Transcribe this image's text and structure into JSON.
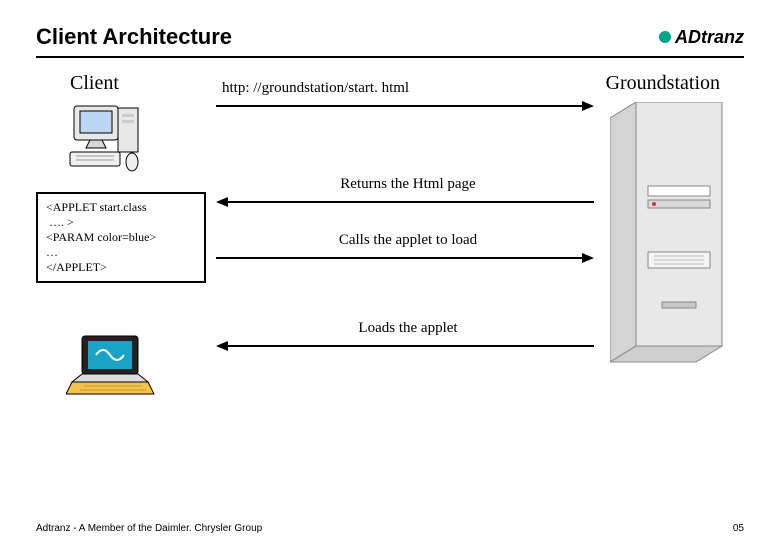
{
  "header": {
    "title": "Client Architecture",
    "logo_text": "ADtranz"
  },
  "columns": {
    "left": "Client",
    "right": "Groundstation"
  },
  "code_box": {
    "line1": "<APPLET start.class",
    "line2": " …. >",
    "line3": "<PARAM color=blue>",
    "line4": "…",
    "line5": "</APPLET>"
  },
  "steps": {
    "request_url": "http: //groundstation/start. html",
    "return_page": "Returns the Html page",
    "call_applet": "Calls the applet to load",
    "load_applet": "Loads the applet"
  },
  "footer": {
    "text": "Adtranz - A Member of the Daimler. Chrysler Group",
    "page_number": "05"
  }
}
